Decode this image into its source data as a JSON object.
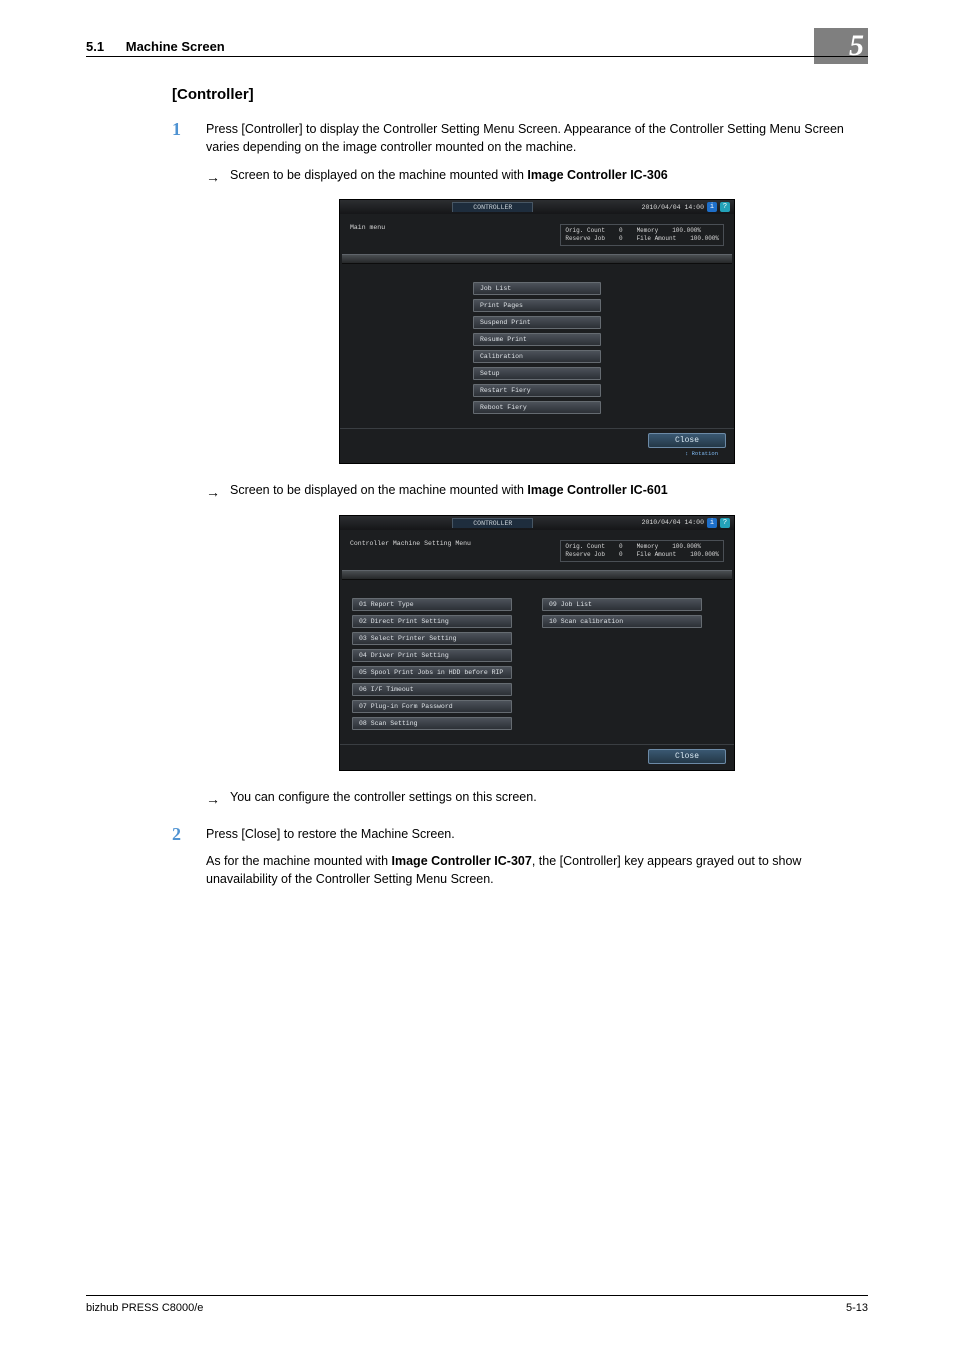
{
  "header": {
    "section_no": "5.1",
    "section_title": "Machine Screen",
    "chapter_no": "5"
  },
  "title": "[Controller]",
  "steps": {
    "s1": {
      "num": "1",
      "txt1": "Press [Controller] to display the Controller Setting Menu Screen. Appearance of the Controller Setting Menu Screen varies depending on the image controller mounted on the machine.",
      "arrow1_pre": "Screen to be displayed on the machine mounted with ",
      "arrow1_bold": "Image Controller IC-306",
      "arrow2_pre": "Screen to be displayed on the machine mounted with ",
      "arrow2_bold": "Image Controller IC-601",
      "arrow3": "You can configure the controller settings on this screen."
    },
    "s2": {
      "num": "2",
      "txt1": "Press [Close] to restore the Machine Screen.",
      "txt2_pre": "As for the machine mounted with ",
      "txt2_bold": "Image Controller IC-307",
      "txt2_post": ", the [Controller] key appears grayed out to show unavailability of the Controller Setting Menu Screen."
    }
  },
  "shot306": {
    "tab": "CONTROLLER",
    "timestamp": "2010/04/04  14:00",
    "left_label": "Main menu",
    "status": {
      "orig_count_l": "Orig. Count",
      "orig_count_v": "0",
      "memory_l": "Memory",
      "memory_v": "100.000%",
      "reserve_l": "Reserve Job",
      "reserve_v": "0",
      "file_l": "File Amount",
      "file_v": "100.000%"
    },
    "buttons": [
      "Job List",
      "Print Pages",
      "Suspend Print",
      "Resume Print",
      "Calibration",
      "Setup",
      "Restart Fiery",
      "Reboot Fiery"
    ],
    "close": "Close",
    "rotation": "Rotation"
  },
  "shot601": {
    "tab": "CONTROLLER",
    "timestamp": "2010/04/04  14:00",
    "left_label": "Controller Machine Setting Menu",
    "status": {
      "orig_count_l": "Orig. Count",
      "orig_count_v": "0",
      "memory_l": "Memory",
      "memory_v": "100.000%",
      "reserve_l": "Reserve Job",
      "reserve_v": "0",
      "file_l": "File Amount",
      "file_v": "100.000%"
    },
    "col1": [
      "01 Report Type",
      "02 Direct Print Setting",
      "03 Select Printer Setting",
      "04 Driver Print Setting",
      "05 Spool Print Jobs in HDD before RIP",
      "06 I/F Timeout",
      "07 Plug-in Form Password",
      "08 Scan Setting"
    ],
    "col2": [
      "09 Job List",
      "10 Scan calibration"
    ],
    "close": "Close"
  },
  "footer": {
    "left": "bizhub PRESS C8000/e",
    "right": "5-13"
  }
}
